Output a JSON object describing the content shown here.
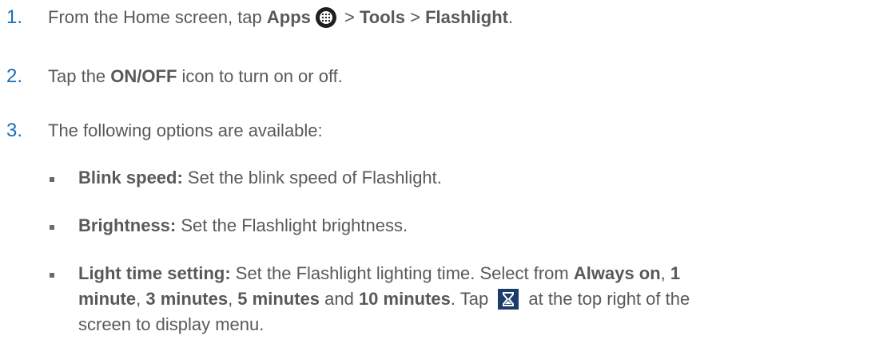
{
  "steps": [
    {
      "number": "1.",
      "pre": "From the Home screen, tap ",
      "apps": "Apps",
      "sep1": " > ",
      "tools": "Tools",
      "sep2": " > ",
      "flashlight": "Flashlight",
      "end": "."
    },
    {
      "number": "2.",
      "pre": "Tap the ",
      "onoff": "ON/OFF",
      "post": " icon to turn on or off."
    },
    {
      "number": "3.",
      "text": "The following options are available:"
    }
  ],
  "options": [
    {
      "label": "Blink speed:",
      "text": " Set the blink speed of Flashlight."
    },
    {
      "label": "Brightness:",
      "text": " Set the Flashlight brightness."
    },
    {
      "label": "Light time setting:",
      "text": " Set the Flashlight lighting time. Select from ",
      "opt_always": "Always on",
      "c1": ", ",
      "opt_1a": "1",
      "opt_1b": "minute",
      "c2": ", ",
      "opt_3": "3 minutes",
      "c3": ", ",
      "opt_5": "5 minutes",
      "and": " and ",
      "opt_10": "10 minutes",
      "tap": ". Tap ",
      "after_icon": " at the top right of the",
      "line3": "screen to display menu."
    }
  ],
  "icons": {
    "apps_icon": "apps-grid-icon",
    "timer_icon": "hourglass-icon"
  },
  "colors": {
    "step_number": "#1a6fb5",
    "text": "#595959",
    "timer_icon_bg": "#1d3c6a"
  }
}
